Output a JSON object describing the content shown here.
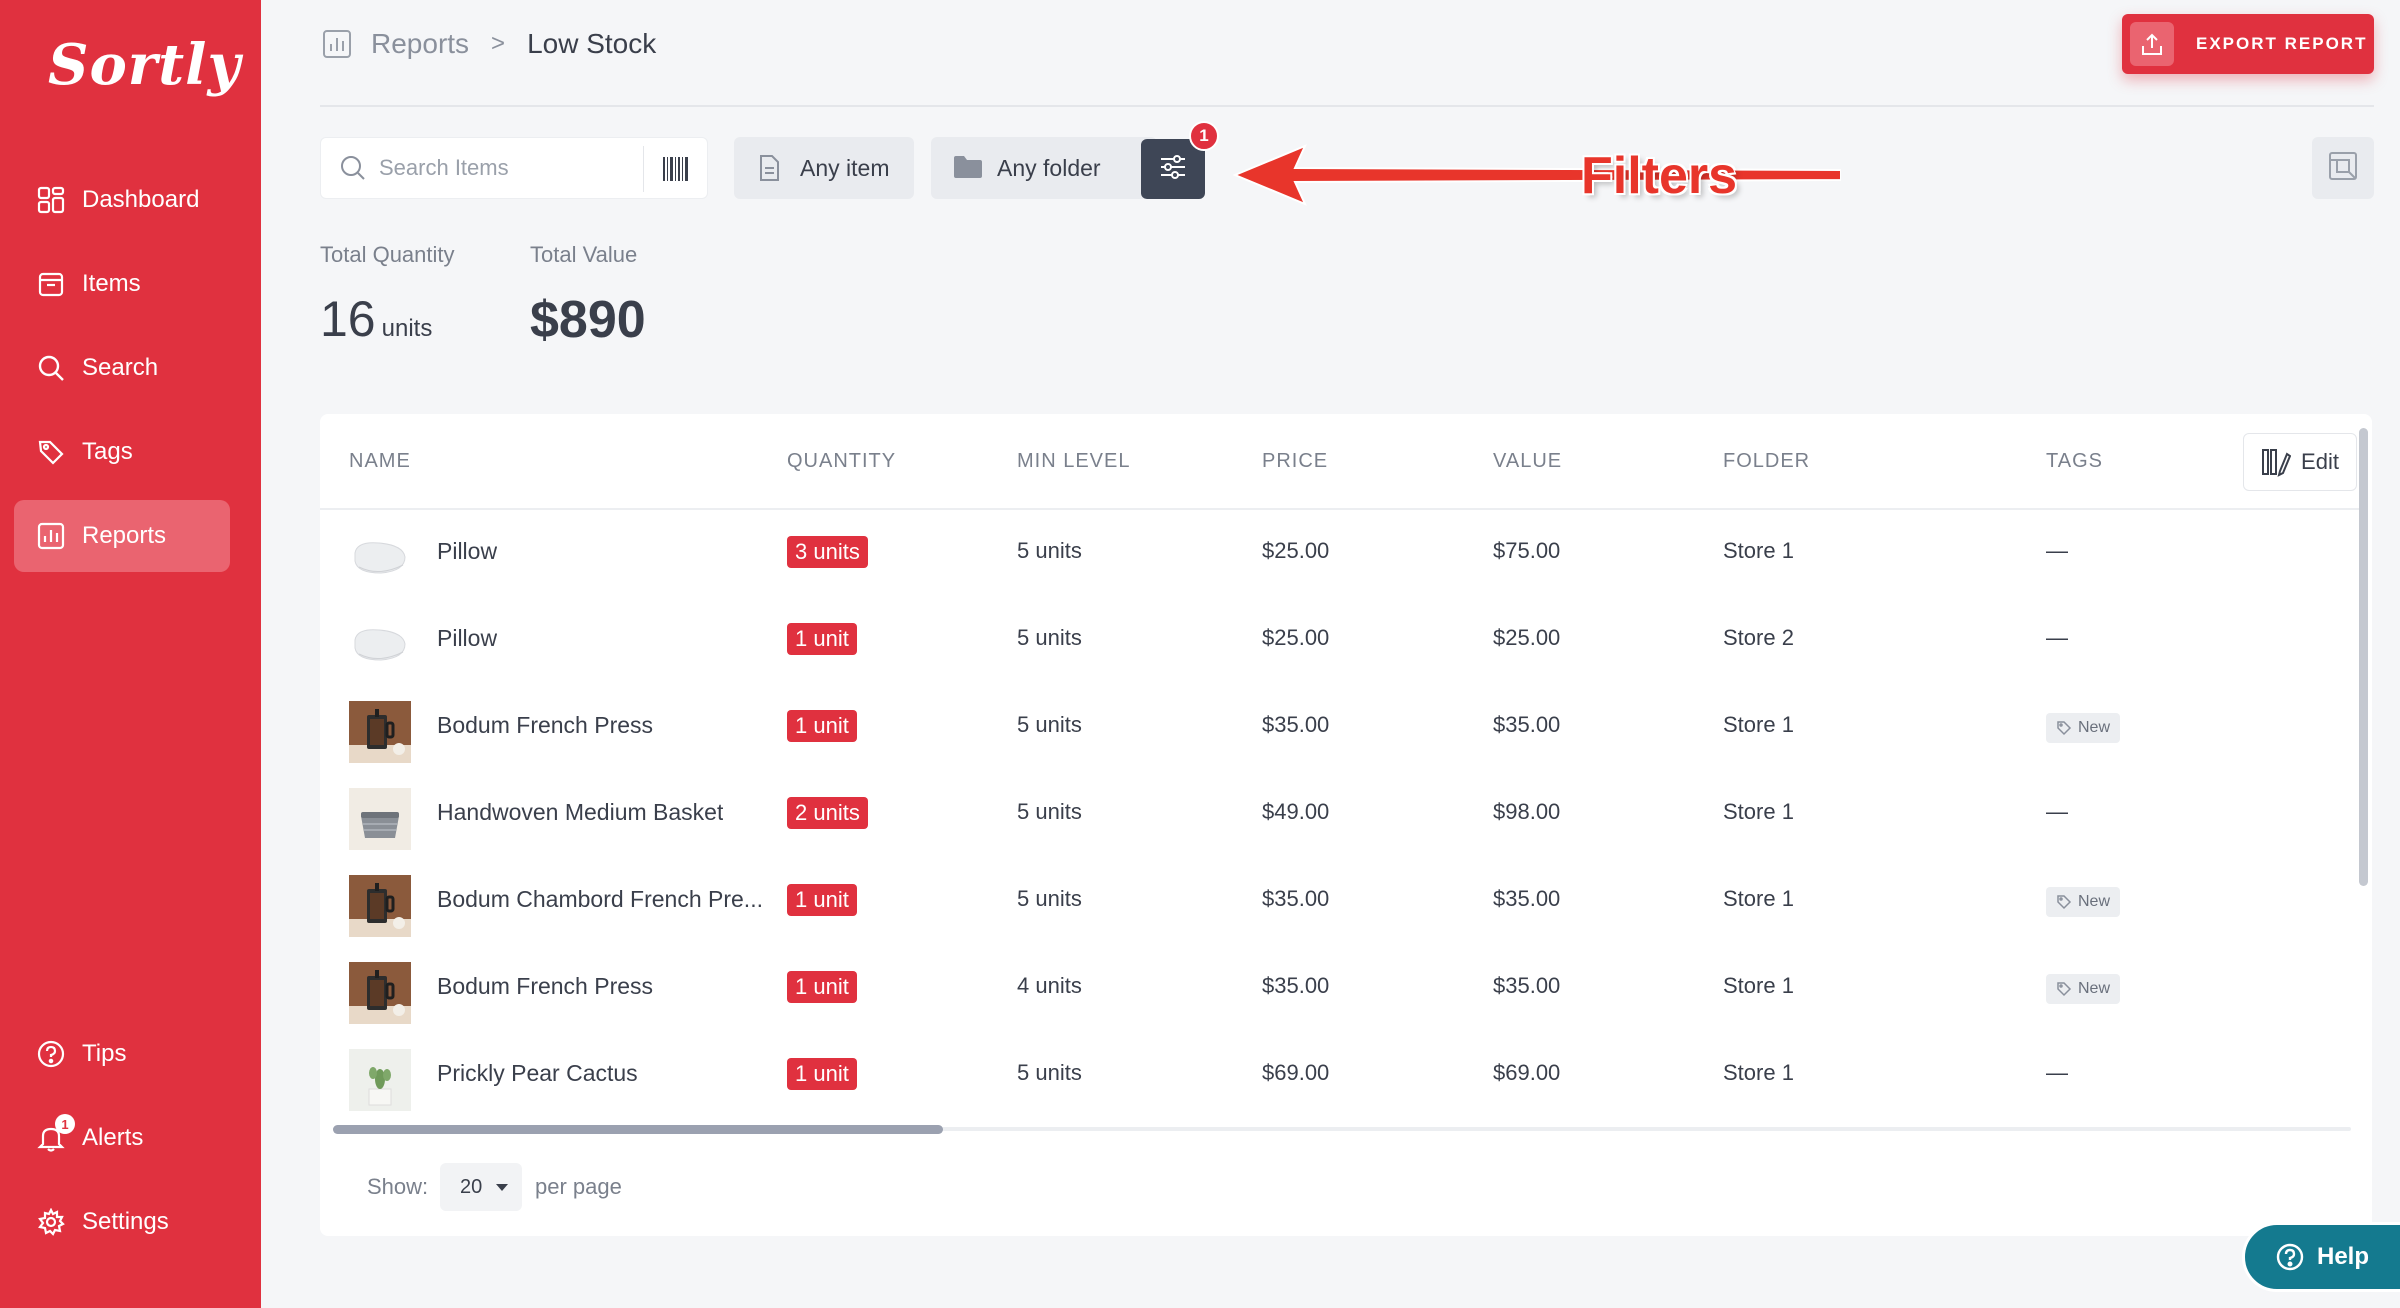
{
  "app": {
    "logo_text": "Sortly",
    "brand_color": "#e0313f"
  },
  "sidebar": {
    "items": [
      {
        "label": "Dashboard",
        "icon": "dashboard-icon"
      },
      {
        "label": "Items",
        "icon": "items-icon"
      },
      {
        "label": "Search",
        "icon": "search-icon"
      },
      {
        "label": "Tags",
        "icon": "tag-icon"
      },
      {
        "label": "Reports",
        "icon": "reports-icon",
        "active": true
      }
    ],
    "bottom_items": [
      {
        "label": "Tips",
        "icon": "help-circle-icon"
      },
      {
        "label": "Alerts",
        "icon": "bell-icon",
        "badge": "1"
      },
      {
        "label": "Settings",
        "icon": "gear-icon"
      }
    ]
  },
  "breadcrumb": {
    "root": "Reports",
    "separator": ">",
    "current": "Low Stock"
  },
  "header": {
    "export_label": "EXPORT REPORT"
  },
  "toolbar": {
    "search_placeholder": "Search Items",
    "item_filter": "Any item",
    "folder_filter": "Any folder",
    "filter_count": "1"
  },
  "annotation": {
    "label": "Filters",
    "color": "#e8352b"
  },
  "stats": {
    "quantity_label": "Total Quantity",
    "quantity_value": "16",
    "quantity_unit": "units",
    "value_label": "Total Value",
    "value_value": "$890"
  },
  "table": {
    "columns": [
      "NAME",
      "QUANTITY",
      "MIN LEVEL",
      "PRICE",
      "VALUE",
      "FOLDER",
      "TAGS"
    ],
    "edit_label": "Edit",
    "rows": [
      {
        "name": "Pillow",
        "quantity": "3 units",
        "min_level": "5 units",
        "price": "$25.00",
        "value": "$75.00",
        "folder": "Store 1",
        "tag": "—",
        "thumb": "pillow"
      },
      {
        "name": "Pillow",
        "quantity": "1 unit",
        "min_level": "5 units",
        "price": "$25.00",
        "value": "$25.00",
        "folder": "Store 2",
        "tag": "—",
        "thumb": "pillow"
      },
      {
        "name": "Bodum French Press",
        "quantity": "1 unit",
        "min_level": "5 units",
        "price": "$35.00",
        "value": "$35.00",
        "folder": "Store 1",
        "tag": "New",
        "thumb": "press"
      },
      {
        "name": "Handwoven Medium Basket",
        "quantity": "2 units",
        "min_level": "5 units",
        "price": "$49.00",
        "value": "$98.00",
        "folder": "Store 1",
        "tag": "—",
        "thumb": "basket"
      },
      {
        "name": "Bodum Chambord French Pre...",
        "quantity": "1 unit",
        "min_level": "5 units",
        "price": "$35.00",
        "value": "$35.00",
        "folder": "Store 1",
        "tag": "New",
        "thumb": "press"
      },
      {
        "name": "Bodum French Press",
        "quantity": "1 unit",
        "min_level": "4 units",
        "price": "$35.00",
        "value": "$35.00",
        "folder": "Store 1",
        "tag": "New",
        "thumb": "press"
      },
      {
        "name": "Prickly Pear Cactus",
        "quantity": "1 unit",
        "min_level": "5 units",
        "price": "$69.00",
        "value": "$69.00",
        "folder": "Store 1",
        "tag": "—",
        "thumb": "cactus"
      }
    ]
  },
  "pagination": {
    "show_label": "Show:",
    "per_page_value": "20",
    "per_page_label": "per page"
  },
  "help": {
    "label": "Help"
  }
}
